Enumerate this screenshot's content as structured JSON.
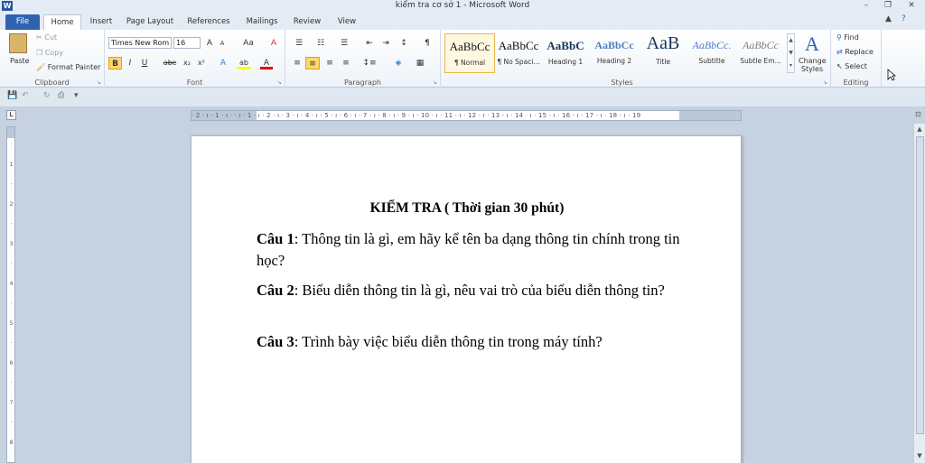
{
  "window": {
    "app_icon": "W",
    "title": "kiểm tra cơ sở 1 - Microsoft Word",
    "controls": [
      "–",
      "❐",
      "✕"
    ]
  },
  "tabs": [
    "File",
    "Home",
    "Insert",
    "Page Layout",
    "References",
    "Mailings",
    "Review",
    "View"
  ],
  "active_tab": "Home",
  "ribbon": {
    "clipboard": {
      "label": "Clipboard",
      "paste": "Paste",
      "cut": "Cut",
      "copy": "Copy",
      "format_painter": "Format Painter"
    },
    "font": {
      "label": "Font",
      "font_name": "Times New Rom",
      "font_size": "16",
      "grow": "A",
      "shrink": "A",
      "change_case": "Aa",
      "clear": "A",
      "bold": "B",
      "italic": "I",
      "underline": "U",
      "strike": "abc",
      "subscript": "x₂",
      "superscript": "x²",
      "effects": "A",
      "highlight": "ab",
      "font_color": "A"
    },
    "paragraph": {
      "label": "Paragraph"
    },
    "styles": {
      "label": "Styles",
      "items": [
        {
          "sample": "AaBbCc",
          "name": "¶ Normal"
        },
        {
          "sample": "AaBbCc",
          "name": "¶ No Spaci..."
        },
        {
          "sample": "AaBbC",
          "name": "Heading 1"
        },
        {
          "sample": "AaBbCc",
          "name": "Heading 2"
        },
        {
          "sample": "AaB",
          "name": "Title"
        },
        {
          "sample": "AaBbCc.",
          "name": "Subtitle"
        },
        {
          "sample": "AaBbCc",
          "name": "Subtle Em..."
        }
      ],
      "change_styles": "Change Styles"
    },
    "editing": {
      "label": "Editing",
      "find": "Find",
      "replace": "Replace",
      "select": "Select"
    }
  },
  "ruler": {
    "text": "· 2 · ı · 1 · ı ·  · ı · 1 · ı · 2 · ı · 3 · ı · 4 · ı · 5 · ı · 6 · ı · 7 · ı · 8 · ı · 9 · ı · 10 · ı · 11 · ı · 12 · ı · 13 · ı · 14 · ı · 15 · ı · 16 · ı · 17 · ı · 18 · ı · 19"
  },
  "document": {
    "title": "KIỂM TRA ( Thời gian 30 phút)",
    "questions": [
      {
        "label": "Câu 1",
        "text": ": Thông tin là gì, em hãy kể tên ba dạng thông tin chính trong tin học?"
      },
      {
        "label": "Câu 2",
        "text": ": Biểu diễn thông tin là gì, nêu vai trò của biểu diễn thông tin?"
      },
      {
        "label": "Câu 3",
        "text": ": Trình bày việc biểu diễn thông tin trong máy tính?"
      }
    ]
  }
}
